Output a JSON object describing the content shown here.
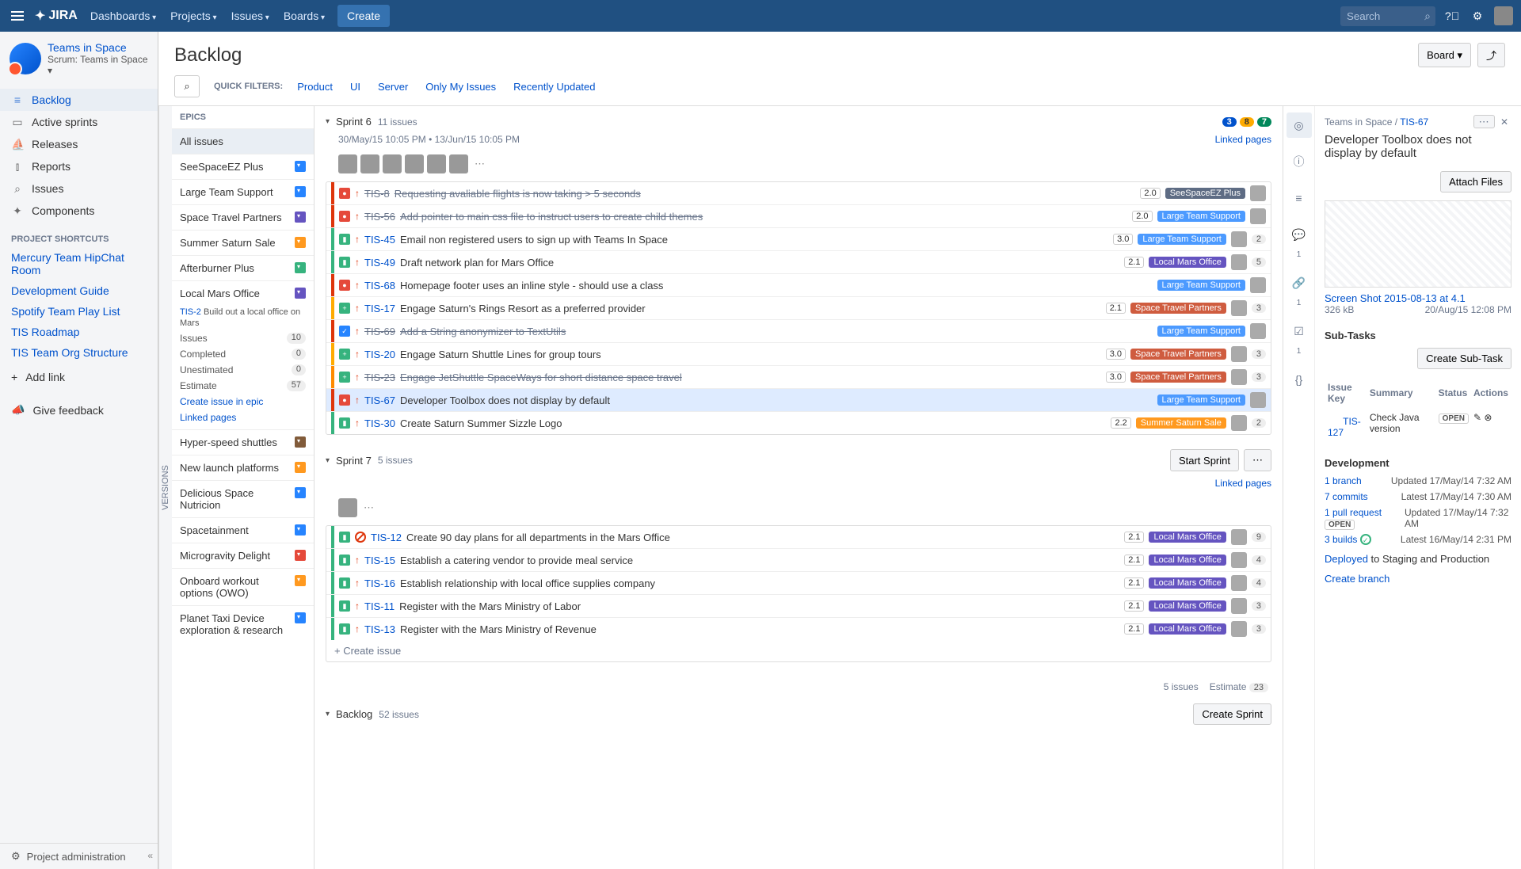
{
  "topnav": {
    "logo": "JIRA",
    "items": [
      "Dashboards",
      "Projects",
      "Issues",
      "Boards"
    ],
    "create": "Create",
    "search_placeholder": "Search"
  },
  "sidebar": {
    "project_name": "Teams in Space",
    "project_sub": "Scrum: Teams in Space",
    "nav": [
      {
        "label": "Backlog",
        "active": true,
        "icon": "≡"
      },
      {
        "label": "Active sprints",
        "icon": "▭"
      },
      {
        "label": "Releases",
        "icon": "⛵"
      },
      {
        "label": "Reports",
        "icon": "⫾"
      },
      {
        "label": "Issues",
        "icon": "⌕"
      },
      {
        "label": "Components",
        "icon": "✦"
      }
    ],
    "shortcuts_title": "PROJECT SHORTCUTS",
    "shortcuts": [
      "Mercury Team HipChat Room",
      "Development Guide",
      "Spotify Team Play List",
      "TIS Roadmap",
      "TIS Team Org Structure"
    ],
    "add_link": "Add link",
    "feedback": "Give feedback",
    "admin": "Project administration"
  },
  "page": {
    "title": "Backlog",
    "board_btn": "Board",
    "quick_filters_label": "QUICK FILTERS:",
    "filters": [
      "Product",
      "UI",
      "Server",
      "Only My Issues",
      "Recently Updated"
    ]
  },
  "versions_tab": "VERSIONS",
  "epics": {
    "title": "EPICS",
    "all_issues": "All issues",
    "items": [
      {
        "name": "SeeSpaceEZ Plus",
        "color": "chip-blue"
      },
      {
        "name": "Large Team Support",
        "color": "chip-blue"
      },
      {
        "name": "Space Travel Partners",
        "color": "chip-purple"
      },
      {
        "name": "Summer Saturn Sale",
        "color": "chip-orange"
      },
      {
        "name": "Afterburner Plus",
        "color": "chip-green"
      }
    ],
    "expanded": {
      "name": "Local Mars Office",
      "color": "chip-purple",
      "key": "TIS-2",
      "desc": "Build out a local office on Mars",
      "stats": [
        {
          "label": "Issues",
          "value": "10"
        },
        {
          "label": "Completed",
          "value": "0"
        },
        {
          "label": "Unestimated",
          "value": "0"
        },
        {
          "label": "Estimate",
          "value": "57"
        }
      ],
      "create_link": "Create issue in epic",
      "linked_pages": "Linked pages"
    },
    "more": [
      {
        "name": "Hyper-speed shuttles",
        "color": "chip-brown"
      },
      {
        "name": "New launch platforms",
        "color": "chip-orange"
      },
      {
        "name": "Delicious Space Nutricion",
        "color": "chip-blue"
      },
      {
        "name": "Spacetainment",
        "color": "chip-blue"
      },
      {
        "name": "Microgravity Delight",
        "color": "chip-pink"
      },
      {
        "name": "Onboard workout options (OWO)",
        "color": "chip-orange"
      },
      {
        "name": "Planet Taxi Device exploration & research",
        "color": "chip-blue"
      }
    ]
  },
  "sprints": [
    {
      "name": "Sprint 6",
      "count": "11 issues",
      "pills": [
        {
          "n": "3",
          "c": "pill-blue"
        },
        {
          "n": "8",
          "c": "pill-yellow"
        },
        {
          "n": "7",
          "c": "pill-green"
        }
      ],
      "dates": "30/May/15 10:05 PM  •  13/Jun/15 10:05 PM",
      "linked": "Linked pages",
      "avatars": 6,
      "issues": [
        {
          "stripe": "stripe-red",
          "type": "ti-bug",
          "prio": "↑",
          "key": "TIS-8",
          "struck": true,
          "sum": "Requesting avaliable flights is now taking > 5 seconds",
          "ver": "2.0",
          "epic": "SeeSpaceEZ Plus",
          "epic_c": "et-grey",
          "badge": ""
        },
        {
          "stripe": "stripe-red",
          "type": "ti-bug",
          "prio": "↑",
          "key": "TIS-56",
          "struck": true,
          "sum": "Add pointer to main css file to instruct users to create child themes",
          "ver": "2.0",
          "epic": "Large Team Support",
          "epic_c": "et-blue",
          "badge": ""
        },
        {
          "stripe": "stripe-green",
          "type": "ti-story",
          "prio": "↑",
          "key": "TIS-45",
          "sum": "Email non registered users to sign up with Teams In Space",
          "ver": "3.0",
          "epic": "Large Team Support",
          "epic_c": "et-blue",
          "badge": "2"
        },
        {
          "stripe": "stripe-green",
          "type": "ti-story",
          "prio": "↑",
          "key": "TIS-49",
          "sum": "Draft network plan for Mars Office",
          "ver": "2.1",
          "epic": "Local Mars Office",
          "epic_c": "et-purple",
          "badge": "5"
        },
        {
          "stripe": "stripe-red",
          "type": "ti-bug",
          "prio": "↑",
          "key": "TIS-68",
          "sum": "Homepage footer uses an inline style - should use a class",
          "ver": "",
          "epic": "Large Team Support",
          "epic_c": "et-blue",
          "badge": ""
        },
        {
          "stripe": "stripe-yellow",
          "type": "ti-story",
          "typelabel": "+",
          "prio": "↑",
          "key": "TIS-17",
          "sum": "Engage Saturn's Rings Resort as a preferred provider",
          "ver": "2.1",
          "epic": "Space Travel Partners",
          "epic_c": "et-pink",
          "badge": "3"
        },
        {
          "stripe": "stripe-red",
          "type": "ti-task",
          "typelabel": "✓",
          "prio": "↑",
          "key": "TIS-69",
          "struck": true,
          "sum": "Add a String anonymizer to TextUtils",
          "ver": "",
          "epic": "Large Team Support",
          "epic_c": "et-blue",
          "badge": ""
        },
        {
          "stripe": "stripe-yellow",
          "type": "ti-story",
          "typelabel": "+",
          "prio": "↑",
          "key": "TIS-20",
          "sum": "Engage Saturn Shuttle Lines for group tours",
          "ver": "3.0",
          "epic": "Space Travel Partners",
          "epic_c": "et-pink",
          "badge": "3"
        },
        {
          "stripe": "stripe-orange",
          "type": "ti-story",
          "typelabel": "+",
          "prio": "↑",
          "key": "TIS-23",
          "struck": true,
          "sum": "Engage JetShuttle SpaceWays for short distance space travel",
          "ver": "3.0",
          "epic": "Space Travel Partners",
          "epic_c": "et-pink",
          "badge": "3"
        },
        {
          "stripe": "stripe-red",
          "type": "ti-bug",
          "prio": "↑",
          "key": "TIS-67",
          "sum": "Developer Toolbox does not display by default",
          "ver": "",
          "epic": "Large Team Support",
          "epic_c": "et-blue",
          "badge": "",
          "selected": true
        },
        {
          "stripe": "stripe-green",
          "type": "ti-story",
          "prio": "↑",
          "key": "TIS-30",
          "sum": "Create Saturn Summer Sizzle Logo",
          "ver": "2.2",
          "epic": "Summer Saturn Sale",
          "epic_c": "et-orange",
          "badge": "2"
        }
      ]
    },
    {
      "name": "Sprint 7",
      "count": "5 issues",
      "start_btn": "Start Sprint",
      "linked": "Linked pages",
      "avatars": 1,
      "issues": [
        {
          "stripe": "stripe-green",
          "type": "ti-story",
          "blocked": true,
          "key": "TIS-12",
          "sum": "Create 90 day plans for all departments in the Mars Office",
          "ver": "2.1",
          "epic": "Local Mars Office",
          "epic_c": "et-purple",
          "badge": "9"
        },
        {
          "stripe": "stripe-green",
          "type": "ti-story",
          "prio": "↑",
          "key": "TIS-15",
          "sum": "Establish a catering vendor to provide meal service",
          "ver": "2.1",
          "epic": "Local Mars Office",
          "epic_c": "et-purple",
          "badge": "4"
        },
        {
          "stripe": "stripe-green",
          "type": "ti-story",
          "prio": "↑",
          "key": "TIS-16",
          "sum": "Establish relationship with local office supplies company",
          "ver": "2.1",
          "epic": "Local Mars Office",
          "epic_c": "et-purple",
          "badge": "4"
        },
        {
          "stripe": "stripe-green",
          "type": "ti-story",
          "prio": "↑",
          "key": "TIS-11",
          "sum": "Register with the Mars Ministry of Labor",
          "ver": "2.1",
          "epic": "Local Mars Office",
          "epic_c": "et-purple",
          "badge": "3"
        },
        {
          "stripe": "stripe-green",
          "type": "ti-story",
          "prio": "↑",
          "key": "TIS-13",
          "sum": "Register with the Mars Ministry of Revenue",
          "ver": "2.1",
          "epic": "Local Mars Office",
          "epic_c": "et-purple",
          "badge": "3"
        }
      ],
      "create_row": "+  Create issue",
      "footer_count": "5 issues",
      "footer_estimate_label": "Estimate",
      "footer_estimate": "23"
    }
  ],
  "backlog_section": {
    "name": "Backlog",
    "count": "52 issues",
    "btn": "Create Sprint"
  },
  "detail": {
    "crumb_project": "Teams in Space",
    "crumb_key": "TIS-67",
    "title": "Developer Toolbox does not display by default",
    "attach_btn": "Attach Files",
    "thumb_name": "Screen Shot 2015-08-13 at 4.1",
    "thumb_size": "326 kB",
    "thumb_date": "20/Aug/15 12:08 PM",
    "subtasks_title": "Sub-Tasks",
    "create_subtask": "Create Sub-Task",
    "sub_headers": [
      "Issue Key",
      "Summary",
      "Status",
      "Actions"
    ],
    "subtask": {
      "key": "TIS-127",
      "sum": "Check Java version",
      "status": "OPEN"
    },
    "dev_title": "Development",
    "dev": [
      {
        "l": "1 branch",
        "r": "Updated 17/May/14 7:32 AM"
      },
      {
        "l": "7 commits",
        "r": "Latest 17/May/14 7:30 AM"
      },
      {
        "l": "1 pull request",
        "badge": "OPEN",
        "r": "Updated 17/May/14 7:32 AM"
      },
      {
        "l": "3 builds",
        "check": true,
        "r": "Latest 16/May/14 2:31 PM"
      }
    ],
    "deployed": "Deployed",
    "deployed_to": " to Staging and Production",
    "create_branch": "Create branch",
    "side_counts": {
      "comments": "1",
      "attachments": "1",
      "subtasks": "1"
    }
  }
}
